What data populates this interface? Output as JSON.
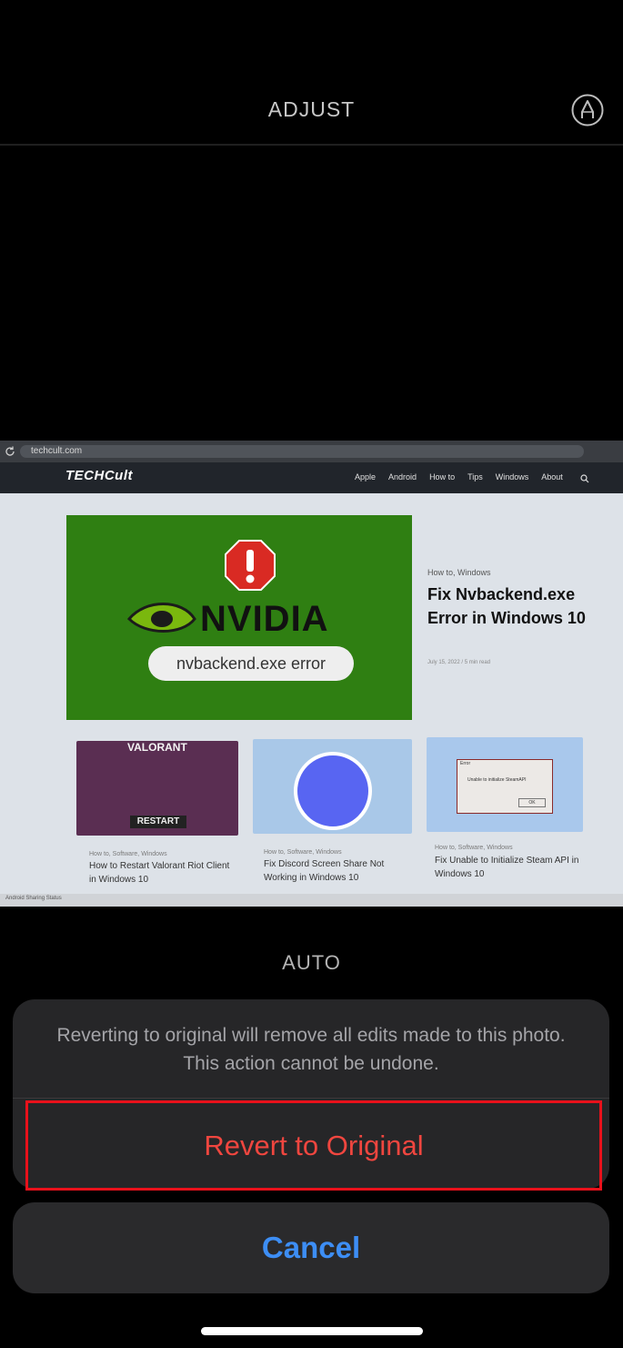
{
  "header": {
    "title": "ADJUST",
    "markup_icon": "markup-pen-icon"
  },
  "photo": {
    "url": "techcult.com",
    "site_logo": "TECHCult",
    "nav": [
      "Apple",
      "Android",
      "How to",
      "Tips",
      "Windows",
      "About"
    ],
    "hero": {
      "brand": "NVIDIA",
      "pill": "nvbackend.exe error",
      "category": "How to, Windows",
      "title": "Fix Nvbackend.exe Error in Windows 10",
      "meta": "July 15, 2022 / 5 min read"
    },
    "cards": [
      {
        "image_title": "VALORANT",
        "tag": "RESTART",
        "category": "How to, Software, Windows",
        "title": "How to Restart Valorant Riot Client in Windows 10"
      },
      {
        "category": "How to, Software, Windows",
        "title": "Fix Discord Screen Share Not Working in Windows 10"
      },
      {
        "dialog_title": "Error",
        "dialog_text": "Unable to initialize SteamAPI",
        "dialog_ok": "OK",
        "category": "How to, Software, Windows",
        "title": "Fix Unable to Initialize Steam API in Windows 10"
      }
    ],
    "taskbar_text": "Android Sharing Status"
  },
  "auto_label": "AUTO",
  "sheet": {
    "message": "Reverting to original will remove all edits made to this photo. This action cannot be undone.",
    "revert_label": "Revert to Original",
    "cancel_label": "Cancel"
  },
  "colors": {
    "destructive": "#f0463f",
    "highlight_border": "#e8111b",
    "accent": "#3d8ef5"
  }
}
